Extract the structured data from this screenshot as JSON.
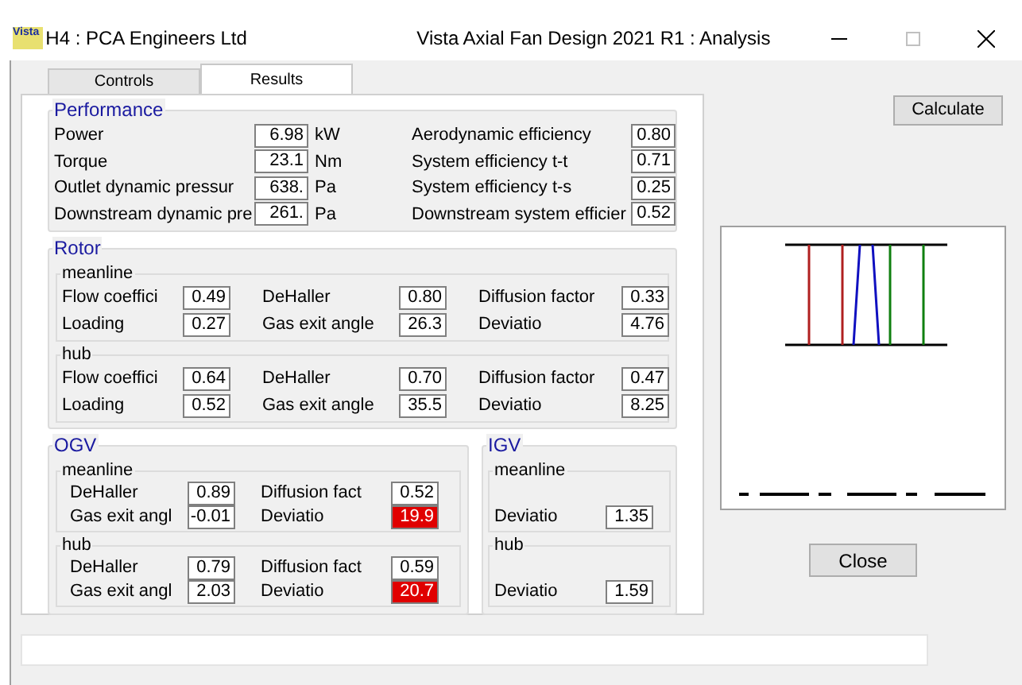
{
  "window": {
    "icon_text": "Vista",
    "owner": "H4 : PCA Engineers Ltd",
    "title": "Vista Axial Fan Design 2021 R1 : Analysis"
  },
  "tabs": [
    {
      "label": "Controls",
      "selected": false
    },
    {
      "label": "Results",
      "selected": true
    }
  ],
  "performance": {
    "title": "Performance",
    "left": [
      {
        "label": "Power",
        "value": "6.98",
        "unit": "kW"
      },
      {
        "label": "Torque",
        "value": "23.1",
        "unit": "Nm"
      },
      {
        "label": "Outlet dynamic pressur",
        "value": "638.",
        "unit": "Pa"
      },
      {
        "label": "Downstream dynamic pre",
        "value": "261.",
        "unit": "Pa"
      }
    ],
    "right": [
      {
        "label": "Aerodynamic efficiency",
        "value": "0.80"
      },
      {
        "label": "System efficiency t-t",
        "value": "0.71"
      },
      {
        "label": "System efficiency t-s",
        "value": "0.25"
      },
      {
        "label": "Downstream system efficier",
        "value": "0.52"
      }
    ]
  },
  "rotor": {
    "title": "Rotor",
    "sections": [
      {
        "title": "meanline",
        "fields": [
          {
            "label": "Flow coeffici",
            "value": "0.49",
            "alert": false
          },
          {
            "label": "DeHaller",
            "value": "0.80",
            "alert": false
          },
          {
            "label": "Diffusion factor",
            "value": "0.33",
            "alert": false
          },
          {
            "label": "Loading",
            "value": "0.27",
            "alert": false
          },
          {
            "label": "Gas exit angle",
            "value": "26.3",
            "alert": false
          },
          {
            "label": "Deviatio",
            "value": "4.76",
            "alert": false
          }
        ]
      },
      {
        "title": "hub",
        "fields": [
          {
            "label": "Flow coeffici",
            "value": "0.64",
            "alert": false
          },
          {
            "label": "DeHaller",
            "value": "0.70",
            "alert": false
          },
          {
            "label": "Diffusion factor",
            "value": "0.47",
            "alert": false
          },
          {
            "label": "Loading",
            "value": "0.52",
            "alert": false
          },
          {
            "label": "Gas exit angle",
            "value": "35.5",
            "alert": false
          },
          {
            "label": "Deviatio",
            "value": "8.25",
            "alert": false
          }
        ]
      }
    ]
  },
  "ogv": {
    "title": "OGV",
    "sections": [
      {
        "title": "meanline",
        "fields": [
          {
            "label": "DeHaller",
            "value": "0.89",
            "alert": false
          },
          {
            "label": "Diffusion fact",
            "value": "0.52",
            "alert": false
          },
          {
            "label": "Gas exit angl",
            "value": "-0.01",
            "alert": false
          },
          {
            "label": "Deviatio",
            "value": "19.9",
            "alert": true
          }
        ]
      },
      {
        "title": "hub",
        "fields": [
          {
            "label": "DeHaller",
            "value": "0.79",
            "alert": false
          },
          {
            "label": "Diffusion fact",
            "value": "0.59",
            "alert": false
          },
          {
            "label": "Gas exit angl",
            "value": "2.03",
            "alert": false
          },
          {
            "label": "Deviatio",
            "value": "20.7",
            "alert": true
          }
        ]
      }
    ]
  },
  "igv": {
    "title": "IGV",
    "sections": [
      {
        "title": "meanline",
        "fields": [
          {
            "label": "Deviatio",
            "value": "1.35",
            "alert": false
          }
        ]
      },
      {
        "title": "hub",
        "fields": [
          {
            "label": "Deviatio",
            "value": "1.59",
            "alert": false
          }
        ]
      }
    ]
  },
  "buttons": {
    "calculate": "Calculate",
    "close": "Close"
  }
}
